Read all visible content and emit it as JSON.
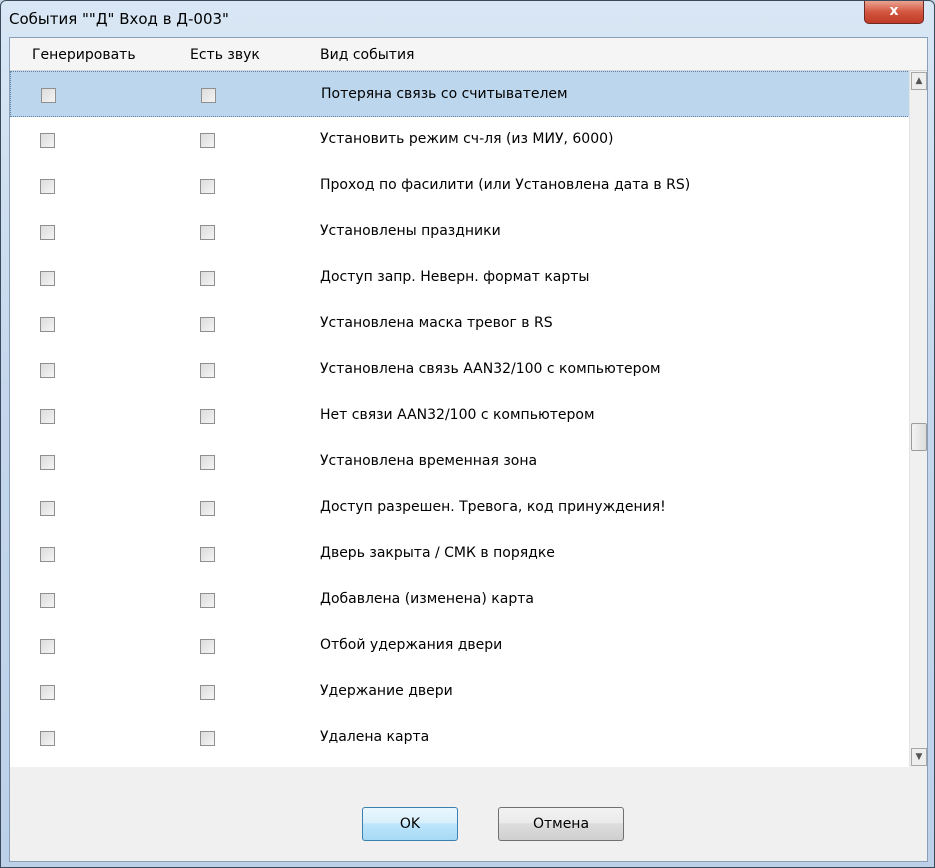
{
  "window": {
    "title": "События \"\"Д\" Вход в Д-003\"",
    "close_label": "x"
  },
  "columns": {
    "generate": "Генерировать",
    "sound": "Есть звук",
    "event_type": "Вид события"
  },
  "events": [
    "Потеряна связь со считывателем",
    "Установить режим сч-ля (из МИУ, 6000)",
    "Проход по фасилити (или Установлена дата в RS)",
    "Установлены праздники",
    "Доступ запр. Неверн. формат карты",
    "Установлена маска тревог в RS",
    "Установлена связь AAN32/100 с  компьютером",
    "Нет связи AAN32/100 с компьютером",
    "Установлена временная зона",
    "Доступ разрешен. Тревога, код принуждения!",
    "Дверь закрыта / СМК в порядке",
    "Добавлена (изменена) карта",
    "Отбой удержания двери",
    "Удержание двери",
    "Удалена карта"
  ],
  "selected_row": 0,
  "scroll_arrows": {
    "up": "▲",
    "down": "▼"
  },
  "buttons": {
    "ok": "OK",
    "cancel": "Отмена"
  }
}
